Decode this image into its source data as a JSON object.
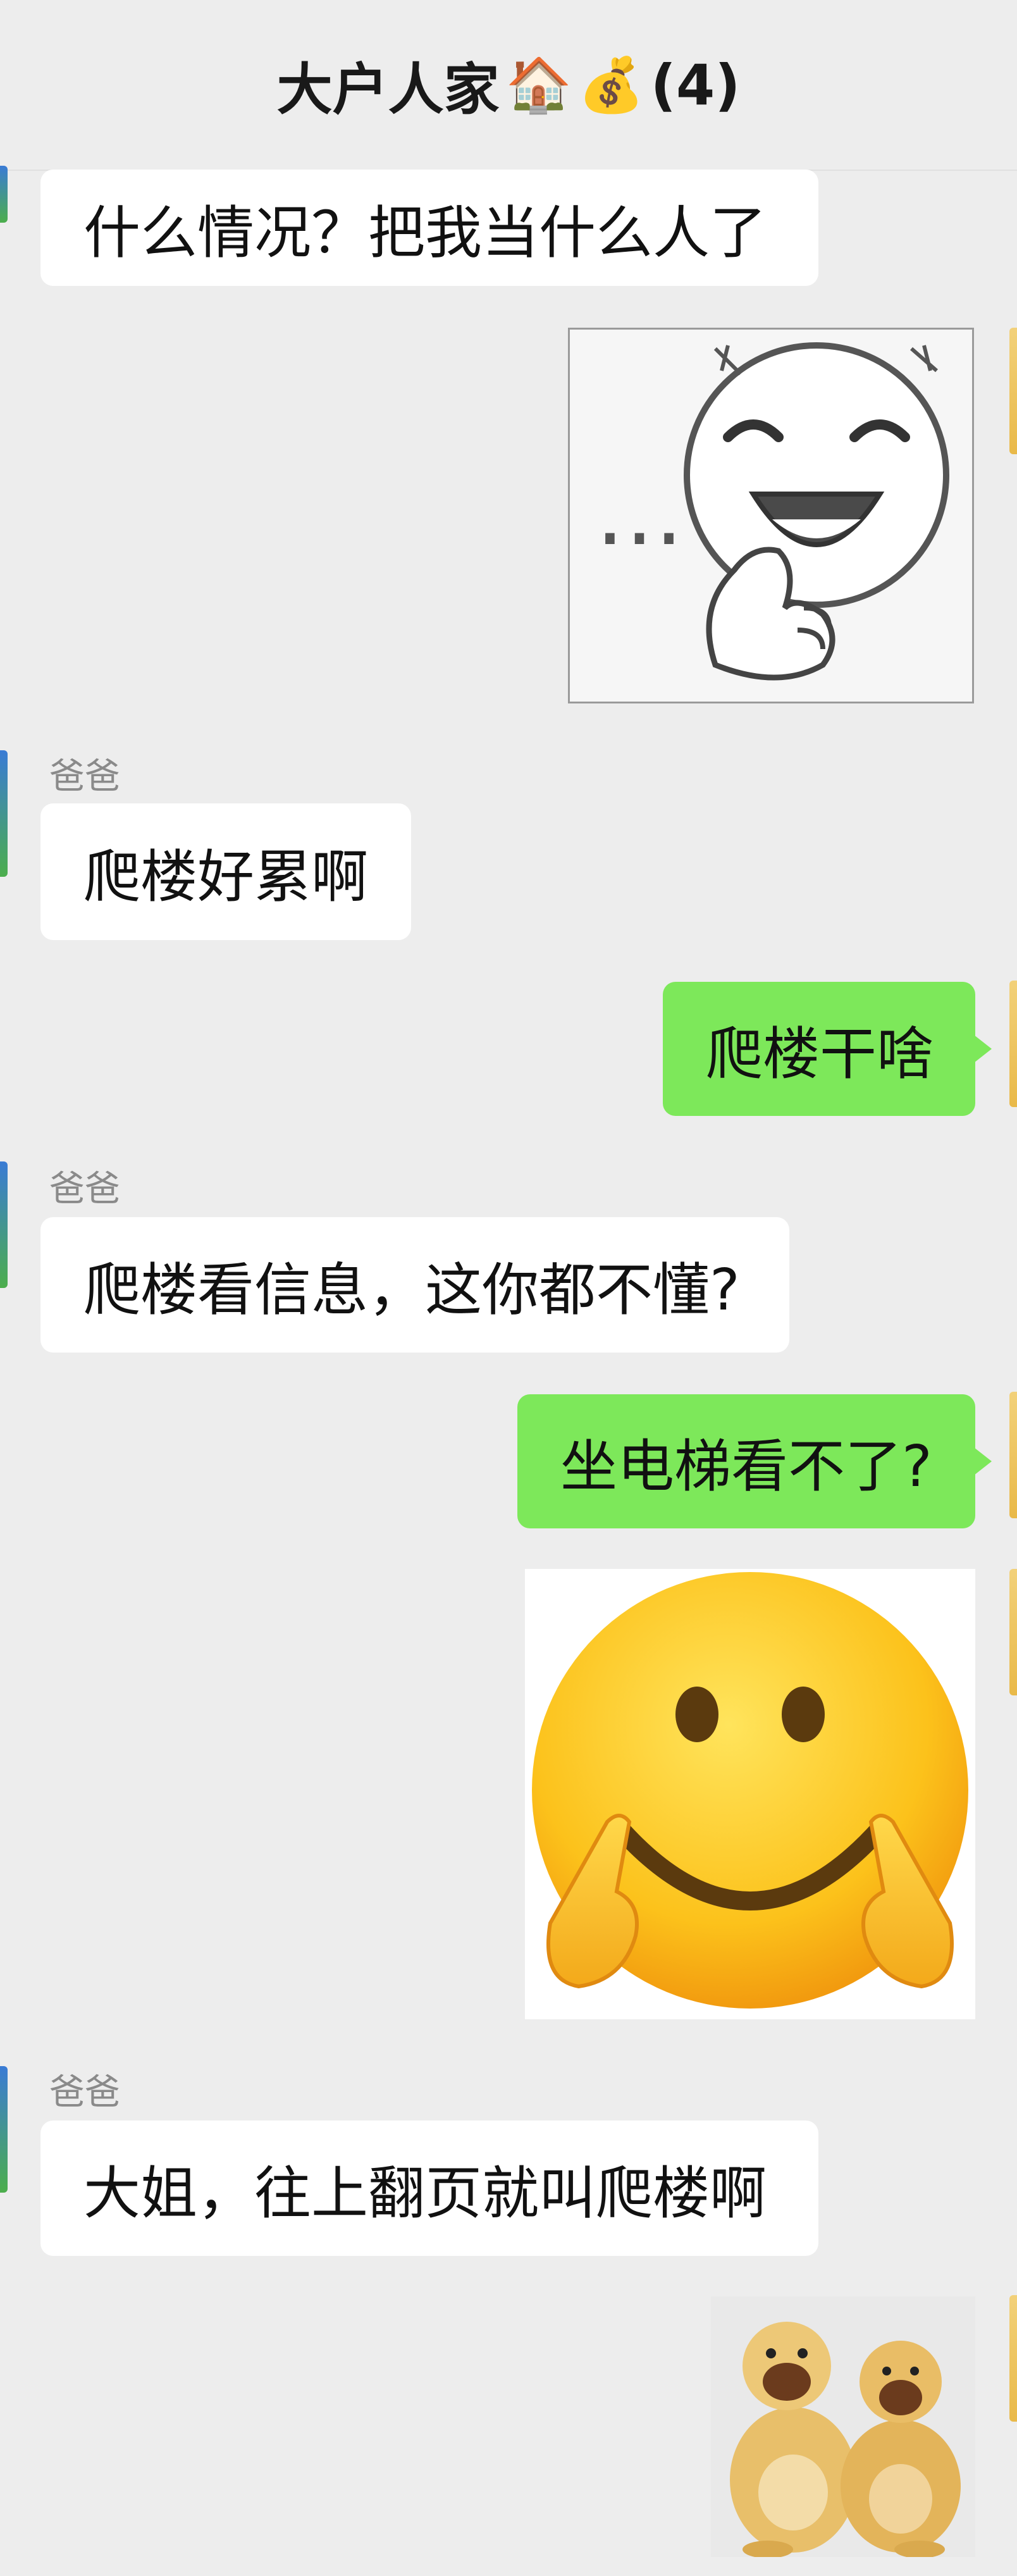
{
  "chat": {
    "title": "大户人家",
    "title_emojis": [
      "🏠",
      "💰"
    ],
    "member_count": "(4)"
  },
  "messages": [
    {
      "side": "left",
      "type": "text",
      "text": "什么情况？把我当什么人了"
    },
    {
      "side": "right",
      "type": "sticker",
      "icon": "thumbs-up-grin-sticker",
      "text": "…"
    },
    {
      "side": "left",
      "type": "text",
      "sender": "爸爸",
      "text": "爬楼好累啊"
    },
    {
      "side": "right",
      "type": "text",
      "text": "爬楼干啥"
    },
    {
      "side": "left",
      "type": "text",
      "sender": "爸爸",
      "text": "爬楼看信息，这你都不懂?"
    },
    {
      "side": "right",
      "type": "text",
      "text": "坐电梯看不了?"
    },
    {
      "side": "right",
      "type": "sticker",
      "icon": "smiling-face-pointing-sticker"
    },
    {
      "side": "left",
      "type": "text",
      "sender": "爸爸",
      "text": "大姐，往上翻页就叫爬楼啊"
    },
    {
      "side": "right",
      "type": "sticker",
      "icon": "laughing-bears-sticker"
    }
  ],
  "colors": {
    "background": "#ededed",
    "left_bubble": "#ffffff",
    "right_bubble": "#7de85a",
    "sender_name": "#8a8a8a"
  }
}
